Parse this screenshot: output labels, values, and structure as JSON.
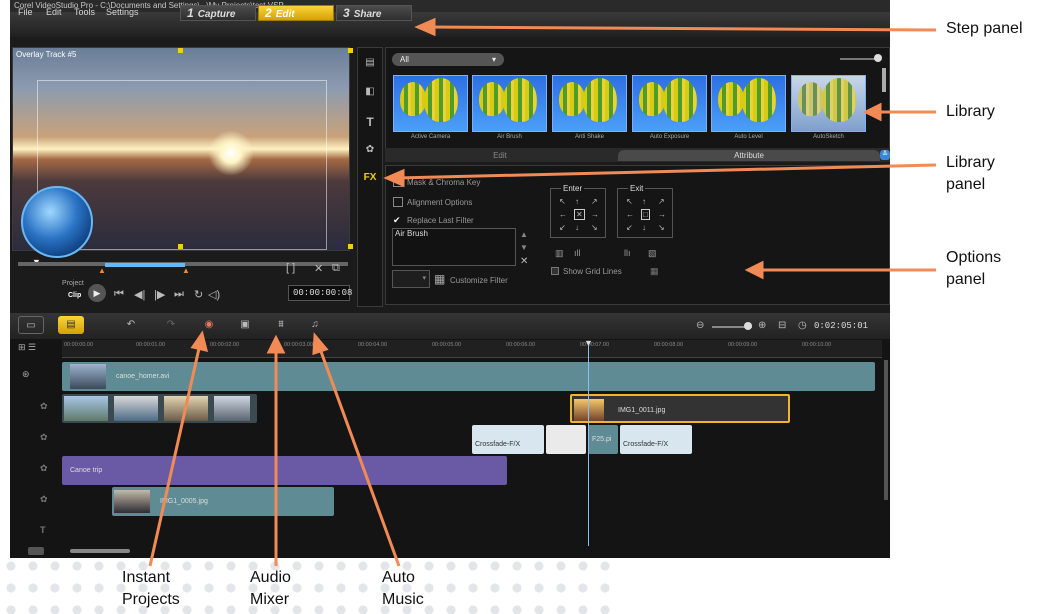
{
  "window": {
    "title": "Corel VideoStudio Pro - C:\\Documents and Settings\\...\\My Projects\\test.VSP"
  },
  "menu": [
    "File",
    "Edit",
    "Tools",
    "Settings"
  ],
  "steps": [
    {
      "num": "1",
      "label": "Capture"
    },
    {
      "num": "2",
      "label": "Edit"
    },
    {
      "num": "3",
      "label": "Share"
    }
  ],
  "preview": {
    "overlay_label": "Overlay Track #5",
    "project_label": "Project",
    "clip_label": "Clip",
    "timecode": "00:00:00:08"
  },
  "library": {
    "category": "All",
    "filters": [
      "Active Camera",
      "Air Brush",
      "Anti Shake",
      "Auto Exposure",
      "Auto Level",
      "AutoSketch"
    ],
    "tabs": [
      "Edit",
      "Attribute"
    ]
  },
  "options": {
    "mask": "Mask & Chroma Key",
    "alignment": "Alignment Options",
    "replace": "Replace Last Filter",
    "filter_item": "Air Brush",
    "customize": "Customize Filter",
    "enter": "Enter",
    "exit": "Exit",
    "grid": "Show Grid Lines"
  },
  "timeline": {
    "zoom_time": "0:02:05:01",
    "ruler": [
      "00:00:00.00",
      "00:00:01.00",
      "00:00:02.00",
      "00:00:03.00",
      "00:00:04.00",
      "00:00:05.00",
      "00:00:06.00",
      "00:00:07.00",
      "00:00:08.00",
      "00:00:09.00",
      "00:00:10.00"
    ],
    "clips": {
      "video": "canoe_homer.avi",
      "img_main": "IMG1_0011.jpg",
      "crossfade": "Crossfade-F/X",
      "f25": "F25.pi",
      "title": "Canoe trip",
      "img_overlay": "IMG1_0005.jpg"
    }
  },
  "callouts": {
    "step_panel": "Step panel",
    "library": "Library",
    "library_panel": "Library panel",
    "options_panel": "Options panel",
    "instant_projects": "Instant Projects",
    "audio_mixer": "Audio Mixer",
    "auto_music": "Auto Music"
  },
  "colors": {
    "accent": "#f28a55",
    "step_active": "#f5c518",
    "track_video": "#5f8c94",
    "track_title": "#6a5aa6"
  }
}
